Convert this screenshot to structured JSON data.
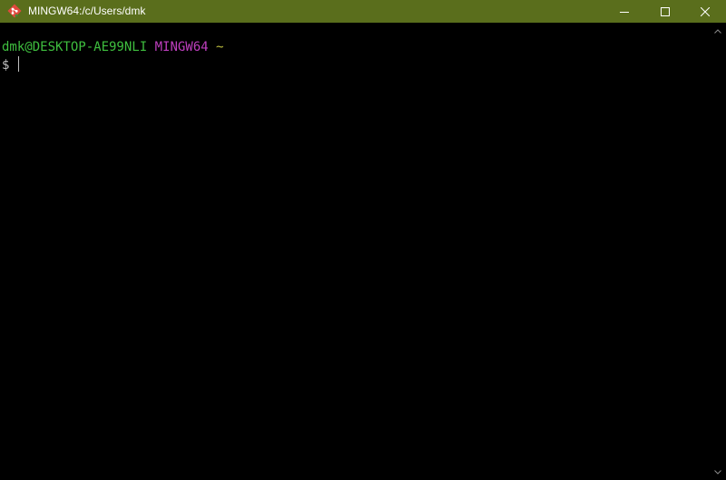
{
  "window": {
    "title": "MINGW64:/c/Users/dmk",
    "titlebar_color": "#5a6e1c",
    "icon": "git-bash-icon",
    "controls": {
      "minimize": "minimize-icon",
      "maximize": "maximize-icon",
      "close": "close-icon"
    }
  },
  "terminal": {
    "background": "#000000",
    "prompt": {
      "user_host": "dmk@DESKTOP-AE99NLI",
      "environment": "MINGW64",
      "cwd": "~",
      "user_host_color": "#3fbf3f",
      "environment_color": "#bf3fbf",
      "cwd_color": "#bfbf3f"
    },
    "input": {
      "symbol": "$",
      "value": ""
    }
  }
}
